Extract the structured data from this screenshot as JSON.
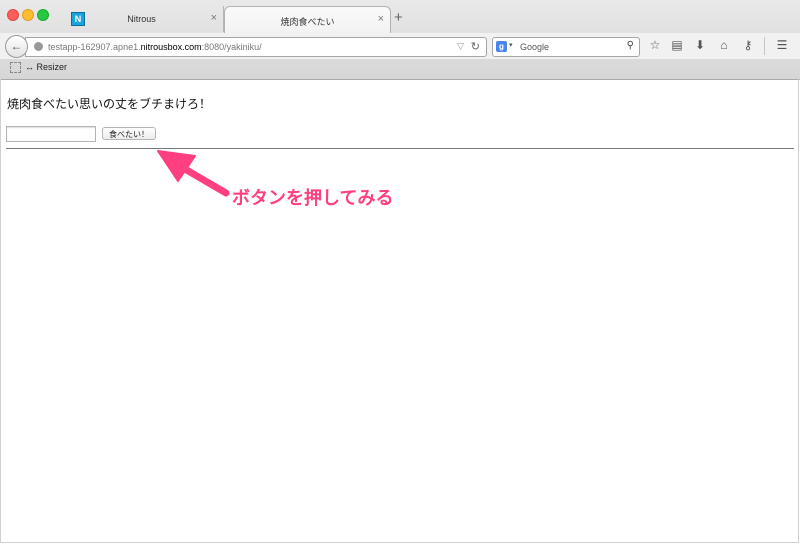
{
  "tabs": [
    {
      "label": "Nitrous",
      "favicon_letter": "N"
    },
    {
      "label": "焼肉食べたい"
    }
  ],
  "tab_close_glyph": "×",
  "new_tab_glyph": "+",
  "url": {
    "prefix": "testapp-162907.apne1.",
    "domain": "nitrousbox.com",
    "suffix": ":8080/yakiniku/"
  },
  "search": {
    "engine_letter": "g",
    "placeholder": "Google"
  },
  "bookmarks": {
    "item": "↔ Resizer"
  },
  "page": {
    "heading": "焼肉食べたい思いの丈をブチまけろ！",
    "input_value": "",
    "button_label": "食べたい！"
  },
  "annotation": {
    "text": "ボタンを押してみる",
    "color": "#ff3f7f"
  },
  "colors": {
    "arrow": "#ff3f7f",
    "favicon": "#1ba3dc",
    "google": "#4a84ec"
  }
}
